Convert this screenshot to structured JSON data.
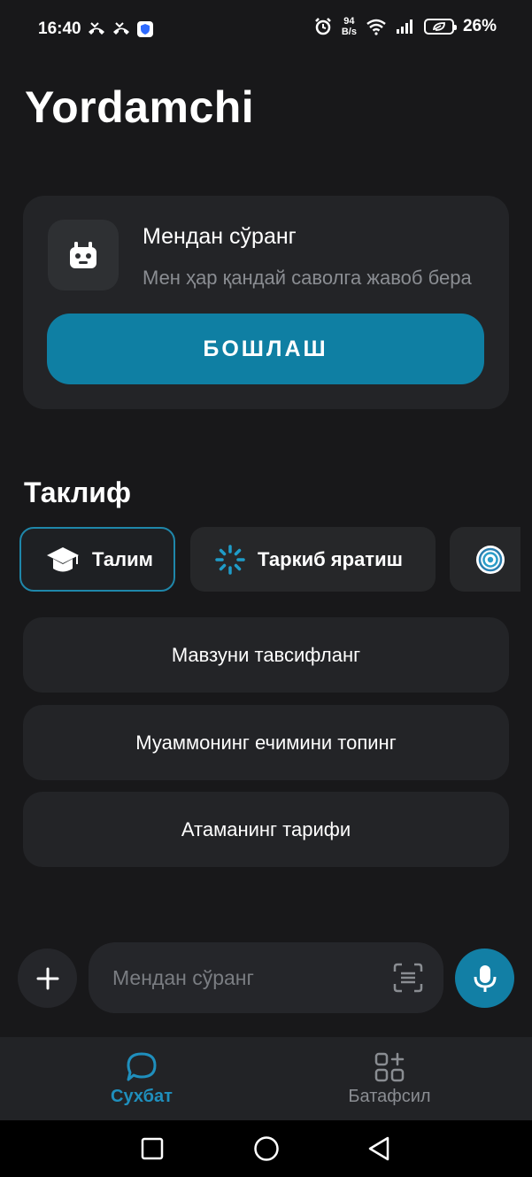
{
  "status_bar": {
    "time": "16:40",
    "net_speed_value": "94",
    "net_speed_unit": "B/s",
    "battery_percent": "26%"
  },
  "app": {
    "title": "Yordamchi"
  },
  "ask_card": {
    "title": "Мендан сўранг",
    "subtitle": "Мен ҳар қандай саволга жавоб бера",
    "start_button_label": "БОШЛАШ"
  },
  "suggestions": {
    "title": "Таклиф",
    "chips": [
      {
        "label": "Талим",
        "icon": "graduation-cap-icon",
        "active": true
      },
      {
        "label": "Таркиб яратиш",
        "icon": "sparkle-spinner-icon",
        "active": false
      },
      {
        "label": "",
        "icon": "target-icon",
        "active": false
      }
    ],
    "prompts": [
      "Мавзуни тавсифланг",
      "Муаммонинг ечимини топинг",
      "Атаманинг тарифи"
    ]
  },
  "composer": {
    "placeholder": "Мендан сўранг"
  },
  "bottom_nav": {
    "items": [
      {
        "label": "Сухбат",
        "icon": "chat-bubble-icon",
        "active": true
      },
      {
        "label": "Батафсил",
        "icon": "grid-plus-icon",
        "active": false
      }
    ]
  },
  "colors": {
    "background": "#18181a",
    "card": "#232427",
    "accent": "#0f7fa3",
    "muted_text": "#8a8d92"
  }
}
